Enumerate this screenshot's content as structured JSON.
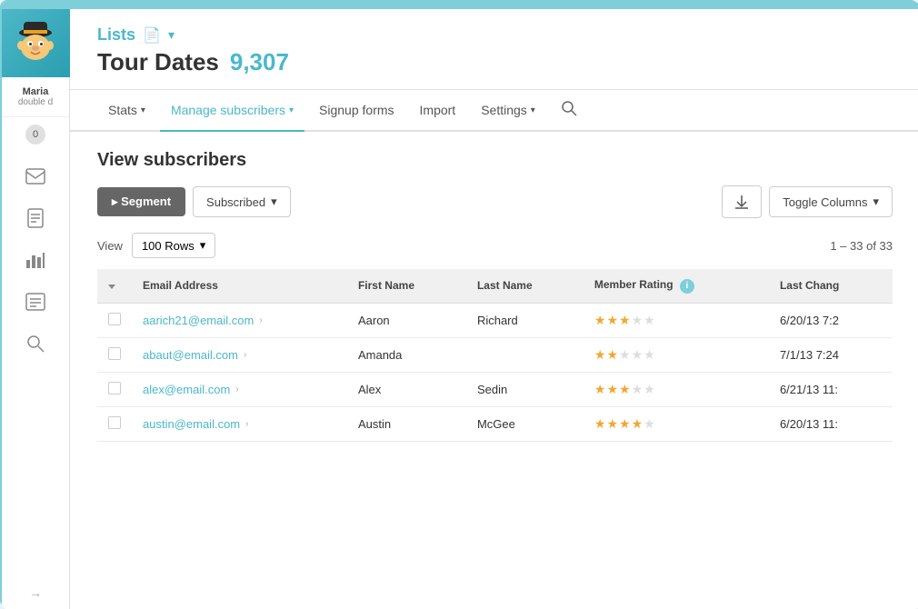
{
  "app": {
    "title": "Mailchimp",
    "top_bar_color": "#7ecfda"
  },
  "sidebar": {
    "user_name": "Maria",
    "user_sub": "double d",
    "badge_count": "0",
    "icons": [
      {
        "name": "envelope-icon",
        "symbol": "✉"
      },
      {
        "name": "document-icon",
        "symbol": "📄"
      },
      {
        "name": "chart-icon",
        "symbol": "📊"
      },
      {
        "name": "campaigns-icon",
        "symbol": "📋"
      },
      {
        "name": "search-icon",
        "symbol": "🔍"
      }
    ],
    "bottom_arrow": "→"
  },
  "breadcrumb": {
    "text": "Lists",
    "doc_icon": "📄",
    "arrow": "▾"
  },
  "page": {
    "title": "Tour Dates",
    "count": "9,307"
  },
  "nav": {
    "items": [
      {
        "label": "Stats",
        "has_caret": true,
        "active": false
      },
      {
        "label": "Manage subscribers",
        "has_caret": true,
        "active": true
      },
      {
        "label": "Signup forms",
        "has_caret": false,
        "active": false
      },
      {
        "label": "Import",
        "has_caret": false,
        "active": false
      },
      {
        "label": "Settings",
        "has_caret": true,
        "active": false
      }
    ],
    "search_symbol": "🔍"
  },
  "view_title": "View subscribers",
  "toolbar": {
    "segment_label": "▸ Segment",
    "subscribed_label": "Subscribed",
    "subscribed_caret": "▾",
    "download_symbol": "⬇",
    "toggle_columns_label": "Toggle Columns",
    "toggle_caret": "▾"
  },
  "view_row": {
    "view_label": "View",
    "rows_label": "100 Rows",
    "rows_caret": "▾",
    "pagination": "1 – 33 of 33"
  },
  "table": {
    "columns": [
      {
        "label": "",
        "key": "check"
      },
      {
        "label": "Email Address",
        "key": "email",
        "sortable": true
      },
      {
        "label": "First Name",
        "key": "first_name"
      },
      {
        "label": "Last Name",
        "key": "last_name"
      },
      {
        "label": "Member Rating",
        "key": "rating",
        "has_info": true
      },
      {
        "label": "Last Chang",
        "key": "last_changed"
      }
    ],
    "rows": [
      {
        "email": "aarich21@email.com",
        "first_name": "Aaron",
        "last_name": "Richard",
        "rating": 3,
        "last_changed": "6/20/13 7:2"
      },
      {
        "email": "abaut@email.com",
        "first_name": "Amanda",
        "last_name": "",
        "rating": 2,
        "last_changed": "7/1/13 7:24"
      },
      {
        "email": "alex@email.com",
        "first_name": "Alex",
        "last_name": "Sedin",
        "rating": 3,
        "last_changed": "6/21/13 11:"
      },
      {
        "email": "austin@email.com",
        "first_name": "Austin",
        "last_name": "McGee",
        "rating": 4,
        "last_changed": "6/20/13 11:"
      }
    ]
  }
}
